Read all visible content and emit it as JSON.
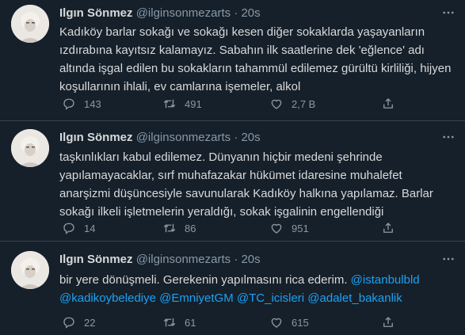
{
  "tweets": [
    {
      "name": "Ilgın Sönmez",
      "handle": "@ilginsonmezarts",
      "separator": "·",
      "time": "20s",
      "text": "Kadıköy barlar sokağı ve sokağı kesen diğer sokaklarda yaşayanların ızdırabına kayıtsız kalamayız. Sabahın ilk saatlerine dek 'eğlence' adı altında işgal edilen bu sokakların tahammül edilemez gürültü kirliliği, hijyen koşullarının ihlali, ev camlarına işemeler, alkol",
      "replies": "143",
      "retweets": "491",
      "likes": "2,7 B"
    },
    {
      "name": "Ilgın Sönmez",
      "handle": "@ilginsonmezarts",
      "separator": "·",
      "time": "20s",
      "text": "taşkınlıkları kabul edilemez. Dünyanın hiçbir medeni şehrinde yapılamayacaklar, sırf muhafazakar hükümet idaresine muhalefet anarşizmi düşüncesiyle savunularak Kadıköy halkına yapılamaz. Barlar sokağı ilkeli işletmelerin yeraldığı, sokak işgalinin engellendiği",
      "replies": "14",
      "retweets": "86",
      "likes": "951"
    },
    {
      "name": "Ilgın Sönmez",
      "handle": "@ilginsonmezarts",
      "separator": "·",
      "time": "20s",
      "text": "bir yere dönüşmeli. Gerekenin yapılmasını rica ederim.",
      "mentions": [
        "@istanbulbld",
        "@kadikoybelediye",
        "@EmniyetGM",
        "@TC_icisleri",
        "@adalet_bakanlik"
      ],
      "replies": "22",
      "retweets": "61",
      "likes": "615"
    }
  ],
  "icons": {
    "more": "more-horizontal-icon",
    "reply": "reply-icon",
    "retweet": "retweet-icon",
    "like": "heart-icon",
    "share": "share-icon"
  },
  "colors": {
    "background": "#15202b",
    "text": "#d9d9d9",
    "secondary": "#8899a6",
    "link": "#1da1f2",
    "divider": "#38444d"
  }
}
